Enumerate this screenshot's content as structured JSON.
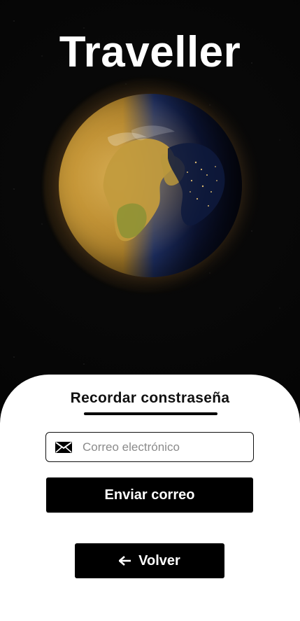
{
  "app": {
    "title": "Traveller"
  },
  "form": {
    "heading": "Recordar constraseña",
    "email_placeholder": "Correo electrónico",
    "email_value": "",
    "send_button_label": "Enviar correo",
    "back_button_label": "Volver"
  },
  "icons": {
    "email": "envelope-icon",
    "back": "arrow-left-icon"
  },
  "colors": {
    "background": "#000000",
    "panel": "#ffffff",
    "primary_button": "#000000",
    "text_dark": "#111111",
    "placeholder": "#8b8b8b"
  }
}
